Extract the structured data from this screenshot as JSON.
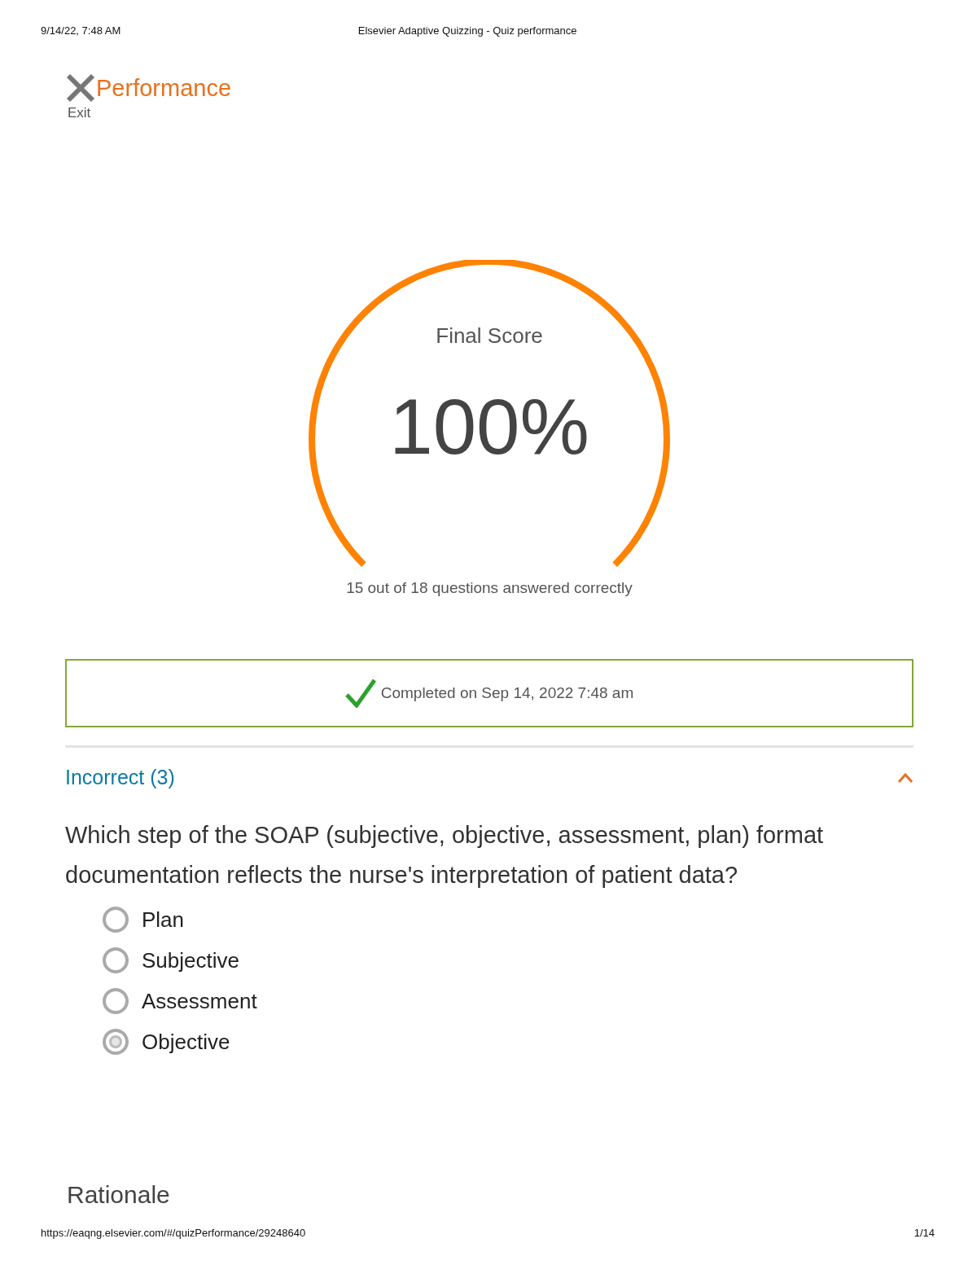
{
  "print_header": {
    "date": "9/14/22, 7:48 AM",
    "title": "Elsevier Adaptive Quizzing - Quiz performance"
  },
  "page": {
    "title": "Performance",
    "exit_label": "Exit"
  },
  "score": {
    "label": "Final Score",
    "value": "100%",
    "level": 1,
    "summary": "15 out of 18 questions answered correctly"
  },
  "completion": {
    "text": "Completed on Sep 14, 2022 7:48 am"
  },
  "section": {
    "title": "Incorrect (3)",
    "expanded": true
  },
  "question": {
    "text": "Which step of the SOAP (subjective, objective, assessment, plan) format documentation reflects the nurse's interpretation of patient data?",
    "options": [
      {
        "label": "Plan",
        "selected": false
      },
      {
        "label": "Subjective",
        "selected": false
      },
      {
        "label": "Assessment",
        "selected": false
      },
      {
        "label": "Objective",
        "selected": true
      }
    ]
  },
  "rationale": {
    "title": "Rationale"
  },
  "print_footer": {
    "url": "https://eaqng.elsevier.com/#/quizPerformance/29248640",
    "page": "1/14"
  }
}
